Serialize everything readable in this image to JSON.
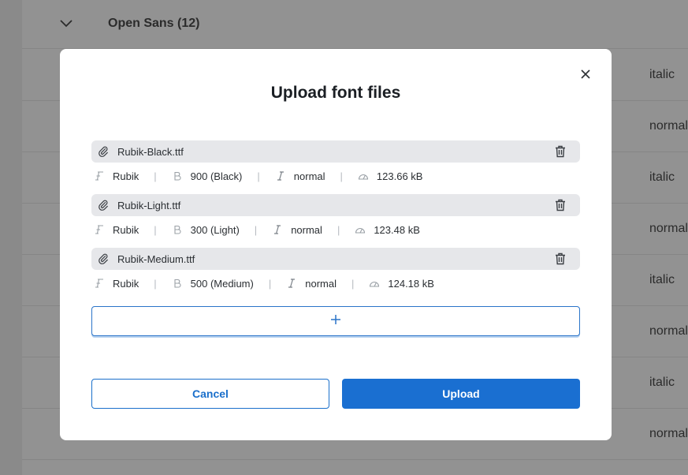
{
  "background": {
    "group_title": "Open Sans (12)",
    "rows": [
      {
        "style": "italic"
      },
      {
        "style": "normal"
      },
      {
        "style": "italic"
      },
      {
        "style": "normal"
      },
      {
        "style": "italic"
      },
      {
        "style": "normal"
      },
      {
        "style": "italic"
      },
      {
        "style": "normal"
      }
    ]
  },
  "modal": {
    "title": "Upload font files",
    "files": [
      {
        "name": "Rubik-Black.ttf",
        "family": "Rubik",
        "weight": "900 (Black)",
        "style": "normal",
        "size": "123.66 kB"
      },
      {
        "name": "Rubik-Light.ttf",
        "family": "Rubik",
        "weight": "300 (Light)",
        "style": "normal",
        "size": "123.48 kB"
      },
      {
        "name": "Rubik-Medium.ttf",
        "family": "Rubik",
        "weight": "500 (Medium)",
        "style": "normal",
        "size": "124.18 kB"
      }
    ],
    "cancel_label": "Cancel",
    "upload_label": "Upload"
  },
  "colors": {
    "accent": "#1a6fd1",
    "file_bar_bg": "#e6e7ea",
    "overlay": "#929292"
  },
  "icons": {
    "close": "close-icon",
    "attachment": "paperclip-icon",
    "delete": "trash-icon",
    "family": "font-family-icon",
    "weight": "bold-icon",
    "style": "italic-icon",
    "size": "gauge-icon",
    "add": "plus-icon",
    "expand": "chevron-down-icon"
  }
}
